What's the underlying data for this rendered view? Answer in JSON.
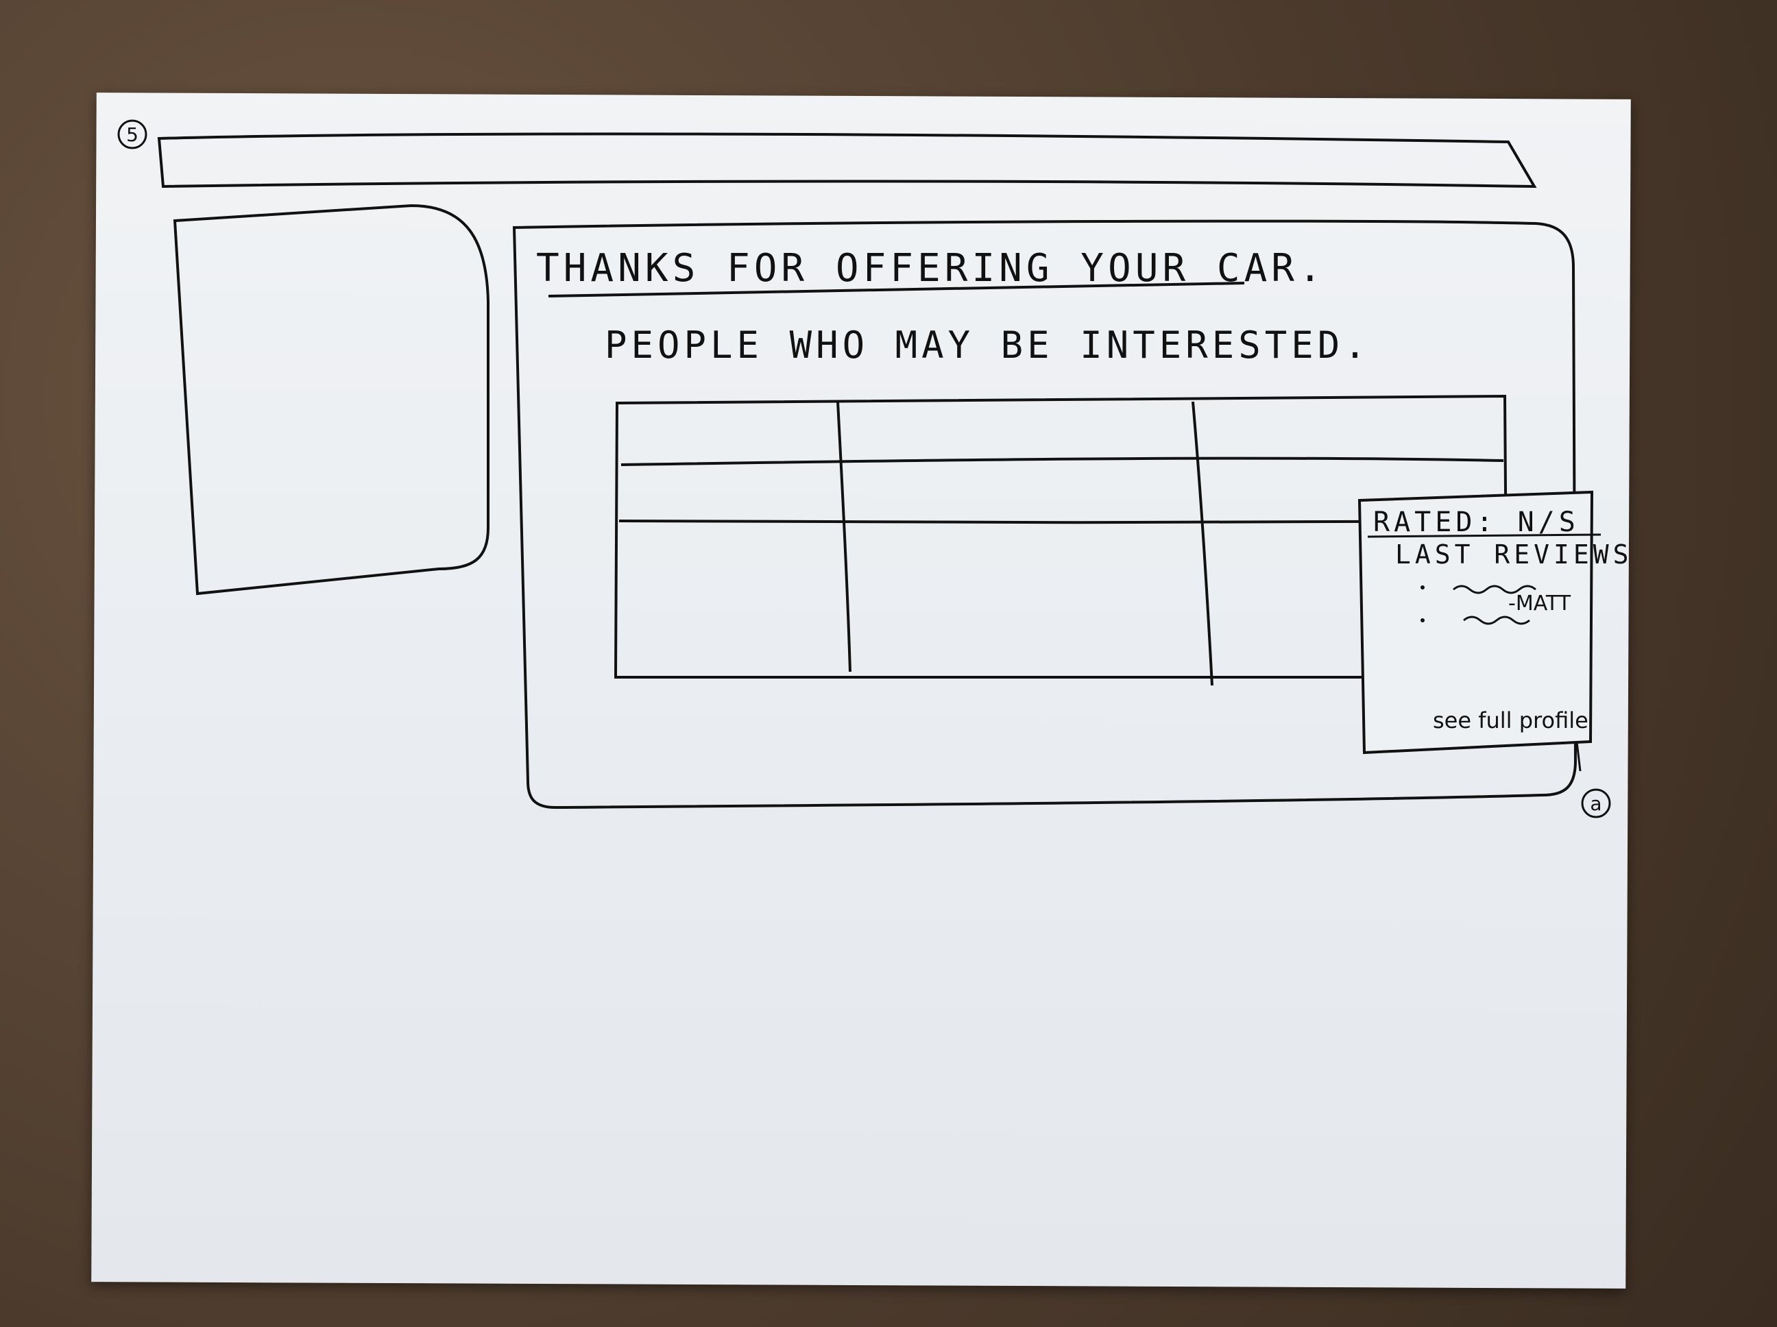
{
  "page_marker": "5",
  "callout_marker": "a",
  "main_panel": {
    "heading": "THANKS FOR OFFERING YOUR CAR.",
    "subheading": "PEOPLE WHO MAY BE INTERESTED."
  },
  "popup": {
    "title": "RATED: N/S",
    "section_label": "LAST REVIEWS",
    "review_author": "-MATT",
    "link_label": "see full profile"
  }
}
